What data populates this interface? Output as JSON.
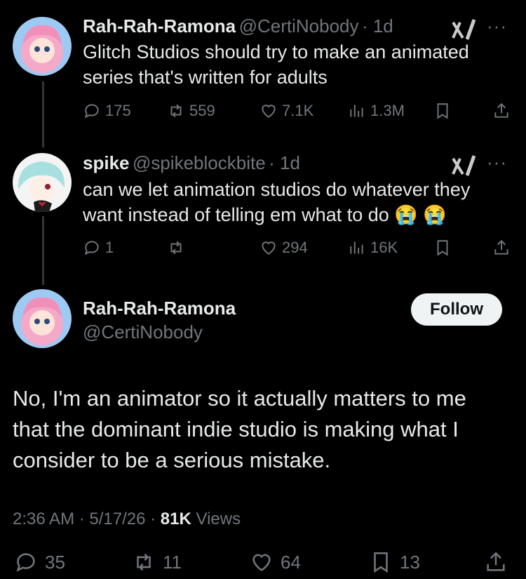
{
  "tweets": [
    {
      "display_name": "Rah-Rah-Ramona",
      "handle": "@CertiNobody",
      "time": "· 1d",
      "text_lines": [
        "Glitch Studios should try to make an animated",
        "series that's written for adults"
      ],
      "replies": "175",
      "retweets": "559",
      "likes": "7.1K",
      "views": "1.3M"
    },
    {
      "display_name": "spike",
      "handle": "@spikeblockbite",
      "time": "· 1d",
      "text_lines": [
        "can we let animation studios do whatever they",
        "want instead of telling em what to do"
      ],
      "emoji": "😭 😭",
      "replies": "1",
      "retweets": "",
      "likes": "294",
      "views": "16K"
    }
  ],
  "main": {
    "display_name": "Rah-Rah-Ramona",
    "handle": "@CertiNobody",
    "follow_label": "Follow",
    "text_lines": [
      "No, I'm an animator so it actually matters to me",
      "that the dominant indie studio is making what I",
      "consider to be a serious mistake."
    ],
    "time": "2:36 AM",
    "date": "5/17/26",
    "views_count": "81K",
    "views_label": "Views",
    "replies": "35",
    "retweets": "11",
    "likes": "64",
    "bookmarks": "13"
  },
  "icons": [
    "more-icon",
    "grok-icon",
    "reply-icon",
    "retweet-icon",
    "like-icon",
    "views-icon",
    "bookmark-icon",
    "share-icon"
  ],
  "colors": {
    "background": "#000000",
    "text": "#e7e9ea",
    "muted": "#71767b",
    "follow_bg": "#eff3f4"
  }
}
